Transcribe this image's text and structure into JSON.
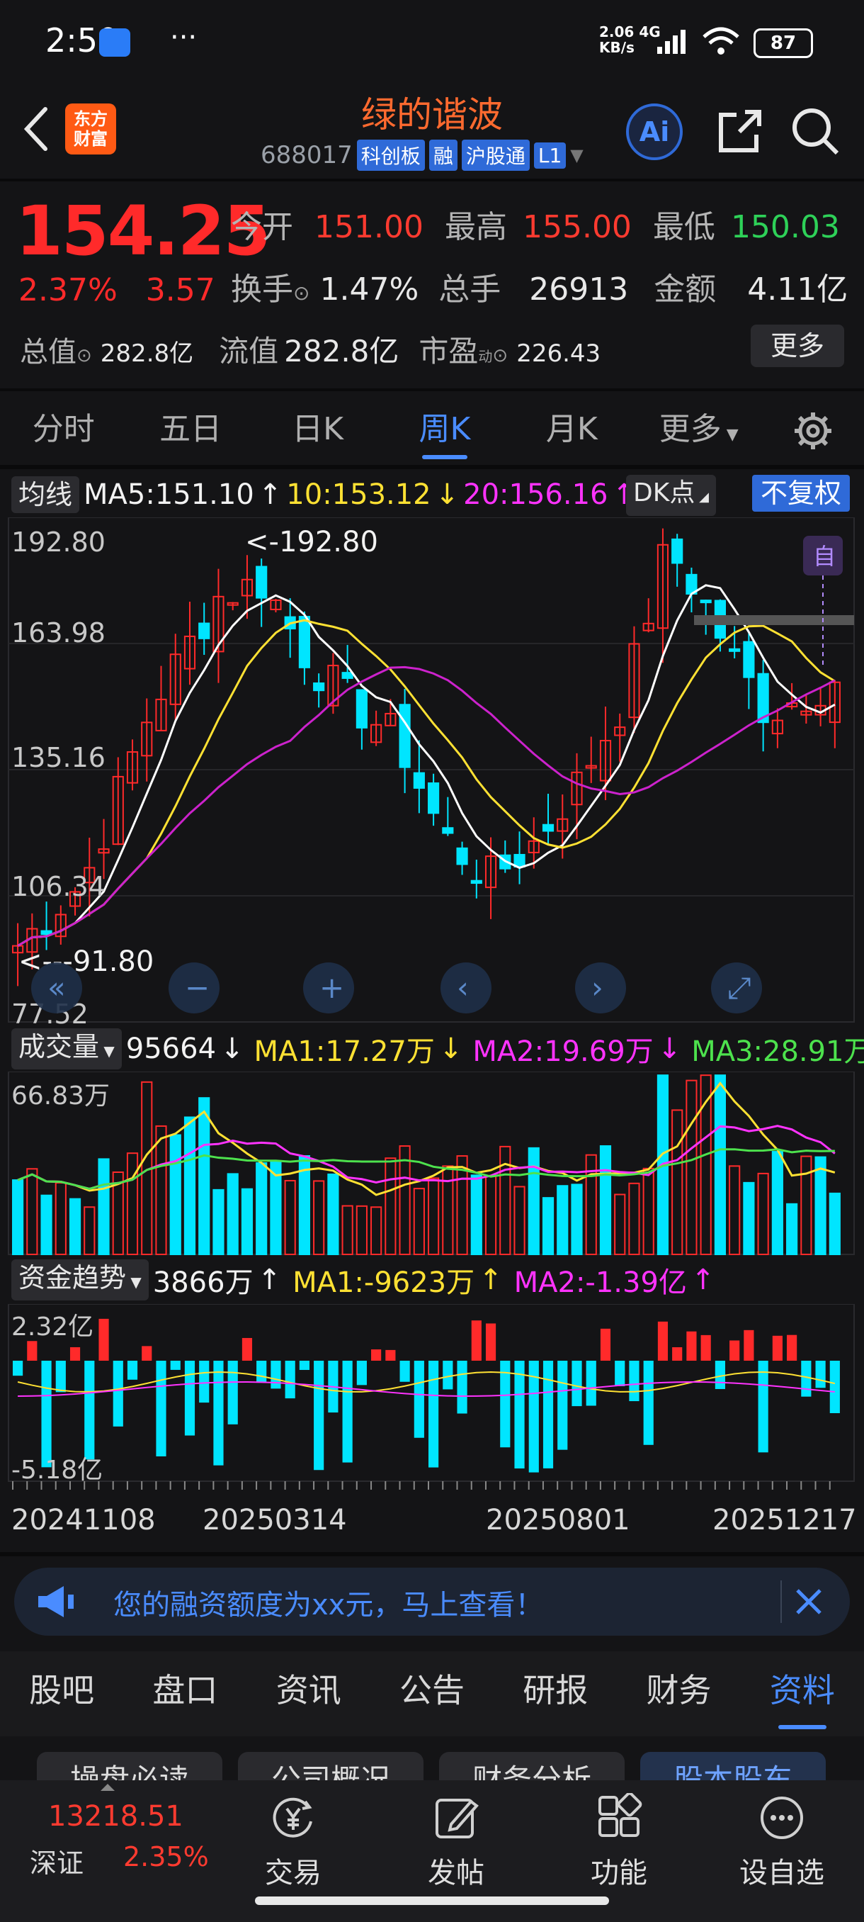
{
  "status_bar": {
    "time": "2:50",
    "net_speed_top": "2.06",
    "net_speed_bottom": "KB/s",
    "net_type": "4G",
    "battery": "87"
  },
  "header": {
    "logo_line1": "东方",
    "logo_line2": "财富",
    "title": "绿的谐波",
    "code": "688017",
    "tags": [
      "科创板",
      "融",
      "沪股通",
      "L1"
    ],
    "ai_label": "Ai"
  },
  "quote": {
    "price": "154.25",
    "change_pct": "2.37%",
    "change_amt": "3.57",
    "open_label": "今开",
    "open": "151.00",
    "high_label": "最高",
    "high": "155.00",
    "low_label": "最低",
    "low": "150.03",
    "turnover_label": "换手",
    "turnover": "1.47%",
    "volume_label": "总手",
    "volume": "26913",
    "amount_label": "金额",
    "amount": "4.11亿",
    "mktcap_label": "总值",
    "mktcap": "282.8亿",
    "float_label": "流值",
    "float": "282.8亿",
    "pe_label": "市盈",
    "pe_sup": "动",
    "pe": "226.43",
    "more_button": "更多"
  },
  "period_tabs": [
    "分时",
    "五日",
    "日K",
    "周K",
    "月K",
    "更多"
  ],
  "active_period": 3,
  "ma_row": {
    "label": "均线",
    "ma5": "MA5:151.10",
    "ma10": "10:153.12",
    "ma20": "20:156.16",
    "dk_button": "DK点",
    "adjust_button": "不复权"
  },
  "kline": {
    "y_labels": [
      "192.80",
      "163.98",
      "135.16",
      "106.34",
      "77.52"
    ],
    "max_annotation": "<-192.80",
    "min_annotation": "<---91.80",
    "self_select_badge": "自"
  },
  "volume_row": {
    "label": "成交量",
    "value": "95664",
    "ma1": "MA1:17.27万",
    "ma2": "MA2:19.69万",
    "ma3": "MA3:28.91万",
    "y_top": "66.83万"
  },
  "fund_row": {
    "label": "资金趋势",
    "value": "3866万",
    "ma1": "MA1:-9623万",
    "ma2": "MA2:-1.39亿",
    "y_top": "2.32亿",
    "y_bottom": "-5.18亿"
  },
  "x_axis_dates": [
    "20241108",
    "20250314",
    "20250801",
    "20251217"
  ],
  "banner": {
    "text": "您的融资额度为xx元，马上查看！"
  },
  "section_tabs": [
    "股吧",
    "盘口",
    "资讯",
    "公告",
    "研报",
    "财务",
    "资料"
  ],
  "active_section": 6,
  "chips": [
    "操盘必读",
    "公司概况",
    "财务分析",
    "股本股东"
  ],
  "bottom_nav": {
    "index_value": "13218.51",
    "index_name": "深证",
    "index_change": "2.35%",
    "items": [
      "交易",
      "发帖",
      "功能",
      "设自选"
    ]
  },
  "colors": {
    "up": "#ff2a2a",
    "down_candle": "#00e5ff",
    "ma5": "#ffffff",
    "ma10": "#ffe133",
    "ma20": "#cc22cc",
    "accent": "#4a8cff",
    "brand": "#ff5a14"
  }
}
